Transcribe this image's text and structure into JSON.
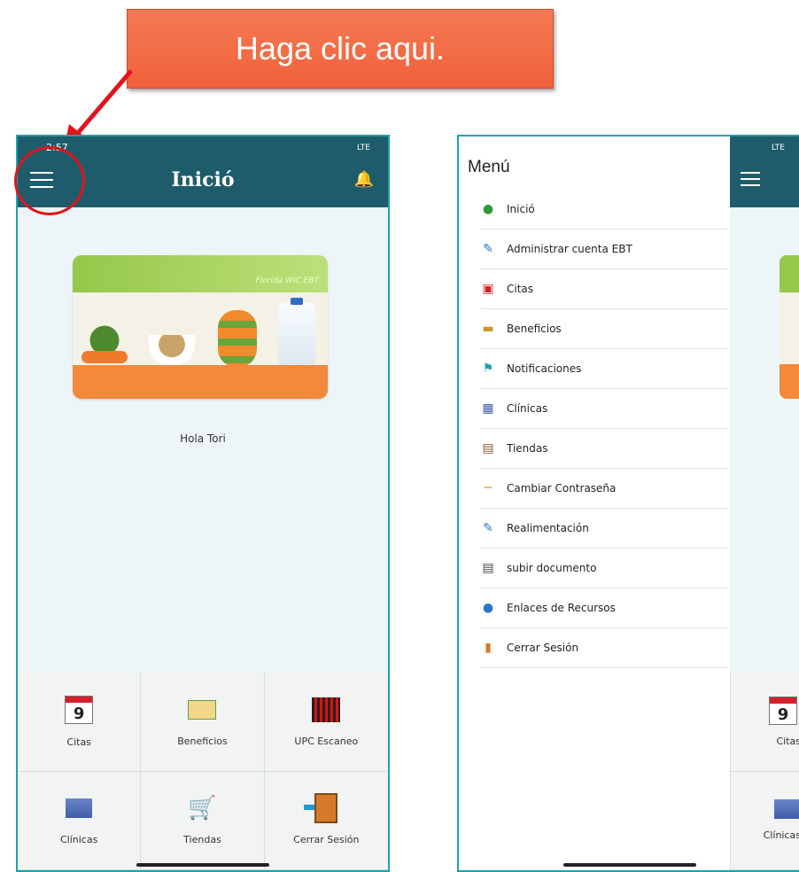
{
  "callout": {
    "text": "Haga clic aqui."
  },
  "colors": {
    "topbar": "#1e5c6b",
    "frame": "#1aa3ad",
    "callout": "#f0613a",
    "highlight": "#e0141c"
  },
  "left_screen": {
    "status_time": "2:57",
    "status_network": "LTE",
    "title": "Inició",
    "menu_icon": "hamburger-menu-icon",
    "notification_icon": "bell-icon",
    "banner_brand": "Florida WIC EBT",
    "greeting": "Hola Tori",
    "tiles": [
      {
        "label": "Citas",
        "icon": "calendar-icon",
        "cal_day": "9"
      },
      {
        "label": "Beneficios",
        "icon": "benefits-icon"
      },
      {
        "label": "UPC Escaneo",
        "icon": "barcode-scan-icon"
      },
      {
        "label": "Clínicas",
        "icon": "clinic-icon"
      },
      {
        "label": "Tiendas",
        "icon": "shopping-cart-icon"
      },
      {
        "label": "Cerrar Sesión",
        "icon": "logout-door-icon"
      }
    ]
  },
  "right_screen": {
    "status_network": "LTE",
    "menu_title": "Menú",
    "menu_items": [
      {
        "label": "Inició",
        "icon": "map-pin-icon"
      },
      {
        "label": "Administrar cuenta EBT",
        "icon": "edit-icon"
      },
      {
        "label": "Citas",
        "icon": "calendar-icon"
      },
      {
        "label": "Beneficios",
        "icon": "benefits-icon"
      },
      {
        "label": "Notificaciones",
        "icon": "bell-icon"
      },
      {
        "label": "Clínicas",
        "icon": "clinic-icon"
      },
      {
        "label": "Tiendas",
        "icon": "shopping-cart-icon"
      },
      {
        "label": "Cambiar Contraseña",
        "icon": "key-icon"
      },
      {
        "label": "Realimentación",
        "icon": "edit-icon"
      },
      {
        "label": "subir documento",
        "icon": "document-upload-icon"
      },
      {
        "label": "Enlaces de Recursos",
        "icon": "globe-icon"
      },
      {
        "label": "Cerrar Sesión",
        "icon": "logout-door-icon"
      }
    ],
    "peek_labels": [
      "Citas",
      "Clínicas"
    ],
    "peek_cal_day": "9"
  }
}
